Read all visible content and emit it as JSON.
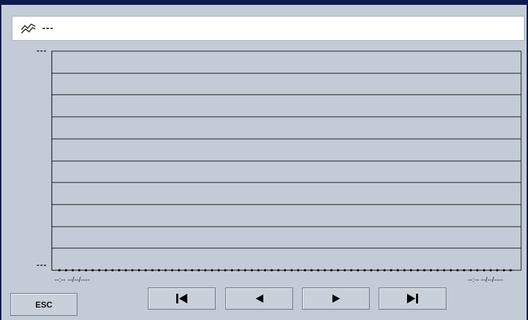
{
  "chart": {
    "title": "---",
    "y_max_label": "---",
    "y_min_label": "---",
    "x_start_label": "--:-- --/--/----",
    "x_end_label": "--:-- --/--/----"
  },
  "buttons": {
    "esc_label": "ESC",
    "first_icon": "skip-first-icon",
    "prev_icon": "previous-icon",
    "next_icon": "next-icon",
    "last_icon": "skip-last-icon"
  },
  "colors": {
    "frame": "#0d1a4d",
    "background": "#c3ccd6",
    "panel": "#ffffff"
  }
}
